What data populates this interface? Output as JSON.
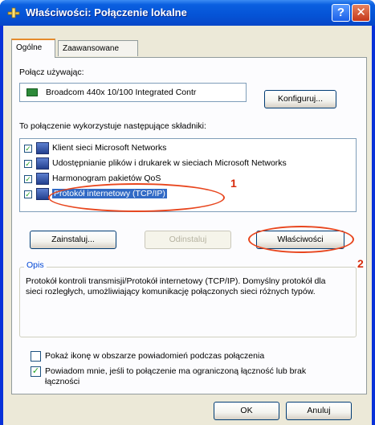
{
  "window": {
    "title": "Właściwości: Połączenie lokalne",
    "help_label": "?",
    "close_label": "✕"
  },
  "tabs": [
    {
      "label": "Ogólne",
      "active": true
    },
    {
      "label": "Zaawansowane",
      "active": false
    }
  ],
  "connect_using": {
    "label": "Połącz używając:",
    "adapter": "Broadcom 440x 10/100 Integrated Contr",
    "configure_label": "Konfiguruj..."
  },
  "components": {
    "label": "To połączenie wykorzystuje następujące składniki:",
    "items": [
      {
        "label": "Klient sieci Microsoft Networks",
        "checked": true,
        "selected": false
      },
      {
        "label": "Udostępnianie plików i drukarek w sieciach Microsoft Networks",
        "checked": true,
        "selected": false
      },
      {
        "label": "Harmonogram pakietów QoS",
        "checked": true,
        "selected": false
      },
      {
        "label": "Protokół internetowy (TCP/IP)",
        "checked": true,
        "selected": true
      }
    ]
  },
  "buttons": {
    "install": "Zainstaluj...",
    "uninstall": "Odinstaluj",
    "properties": "Właściwości",
    "ok": "OK",
    "cancel": "Anuluj"
  },
  "description": {
    "title": "Opis",
    "text": "Protokół kontroli transmisji/Protokół internetowy (TCP/IP). Domyślny protokół dla sieci rozległych, umożliwiający komunikację połączonych sieci różnych typów."
  },
  "options": {
    "show_icon": {
      "label": "Pokaż ikonę w obszarze powiadomień podczas połączenia",
      "checked": false
    },
    "notify": {
      "label": "Powiadom mnie, jeśli to połączenie ma ograniczoną łączność lub brak łączności",
      "checked": true
    }
  },
  "annotations": {
    "marker_1": "1",
    "marker_2": "2",
    "color": "#e8461e"
  },
  "colors": {
    "title_bar": "#0553d6",
    "selection": "#316ac5",
    "tab_highlight": "#e68b2c"
  },
  "icons": {
    "title": "network-connection-icon",
    "adapter": "network-adapter-icon",
    "component": "network-component-icon"
  }
}
